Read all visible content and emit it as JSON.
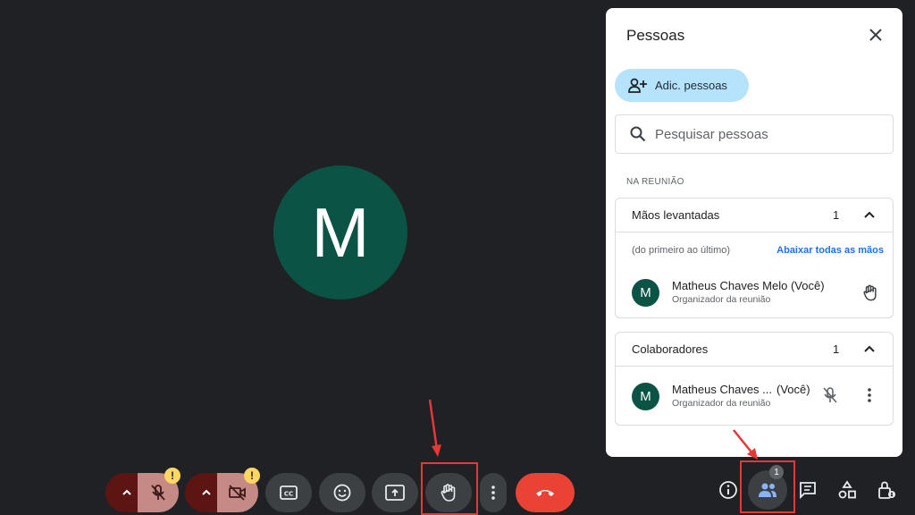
{
  "stage": {
    "avatar_initial": "M"
  },
  "controls": {
    "mic_warning": "!",
    "cam_warning": "!"
  },
  "panel": {
    "title": "Pessoas",
    "add_label": "Adic. pessoas",
    "search_placeholder": "Pesquisar pessoas",
    "section_label": "NA REUNIÃO",
    "raised_hands": {
      "title": "Mãos levantadas",
      "count": "1",
      "order_hint": "(do primeiro ao último)",
      "lower_all": "Abaixar todas as mãos",
      "person": {
        "initial": "M",
        "name": "Matheus Chaves Melo (Você)",
        "role": "Organizador da reunião"
      }
    },
    "collaborators": {
      "title": "Colaboradores",
      "count": "1",
      "person": {
        "initial": "M",
        "name": "Matheus Chaves ...",
        "you": "(Você)",
        "role": "Organizador da reunião"
      }
    }
  },
  "bottom_right": {
    "people_count": "1"
  },
  "colors": {
    "accent": "#1a73e8",
    "end_call": "#ea4335",
    "avatar": "#0b5345",
    "highlight": "#e53935"
  }
}
